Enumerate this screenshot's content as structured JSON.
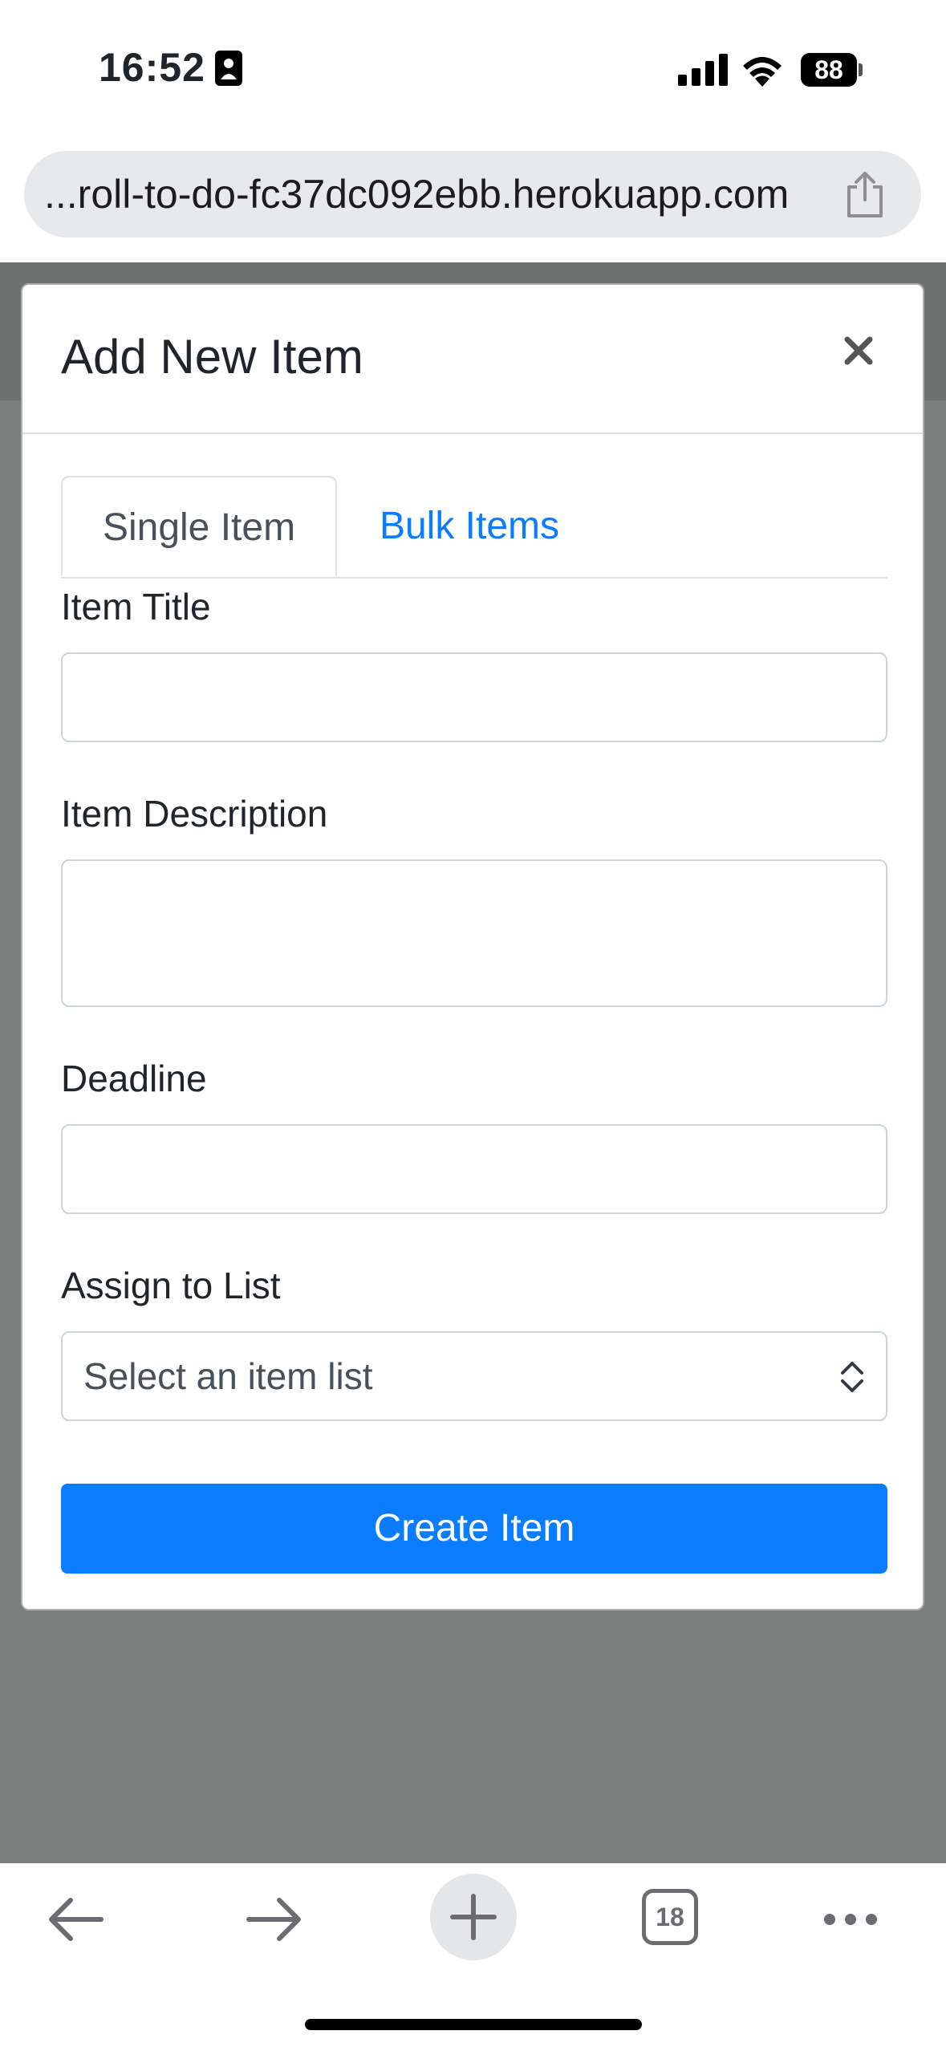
{
  "status_bar": {
    "time": "16:52",
    "battery": "88"
  },
  "browser": {
    "url": "...roll-to-do-fc37dc092ebb.herokuapp.com",
    "tab_count": "18"
  },
  "modal": {
    "title": "Add New Item",
    "tabs": [
      {
        "label": "Single Item",
        "active": true
      },
      {
        "label": "Bulk Items",
        "active": false
      }
    ],
    "fields": {
      "title_label": "Item Title",
      "title_value": "",
      "description_label": "Item Description",
      "description_value": "",
      "deadline_label": "Deadline",
      "deadline_value": "",
      "list_label": "Assign to List",
      "list_selected": "Select an item list"
    },
    "submit_label": "Create Item"
  },
  "colors": {
    "primary": "#0a7cff",
    "backdrop": "#7c7d7d"
  }
}
